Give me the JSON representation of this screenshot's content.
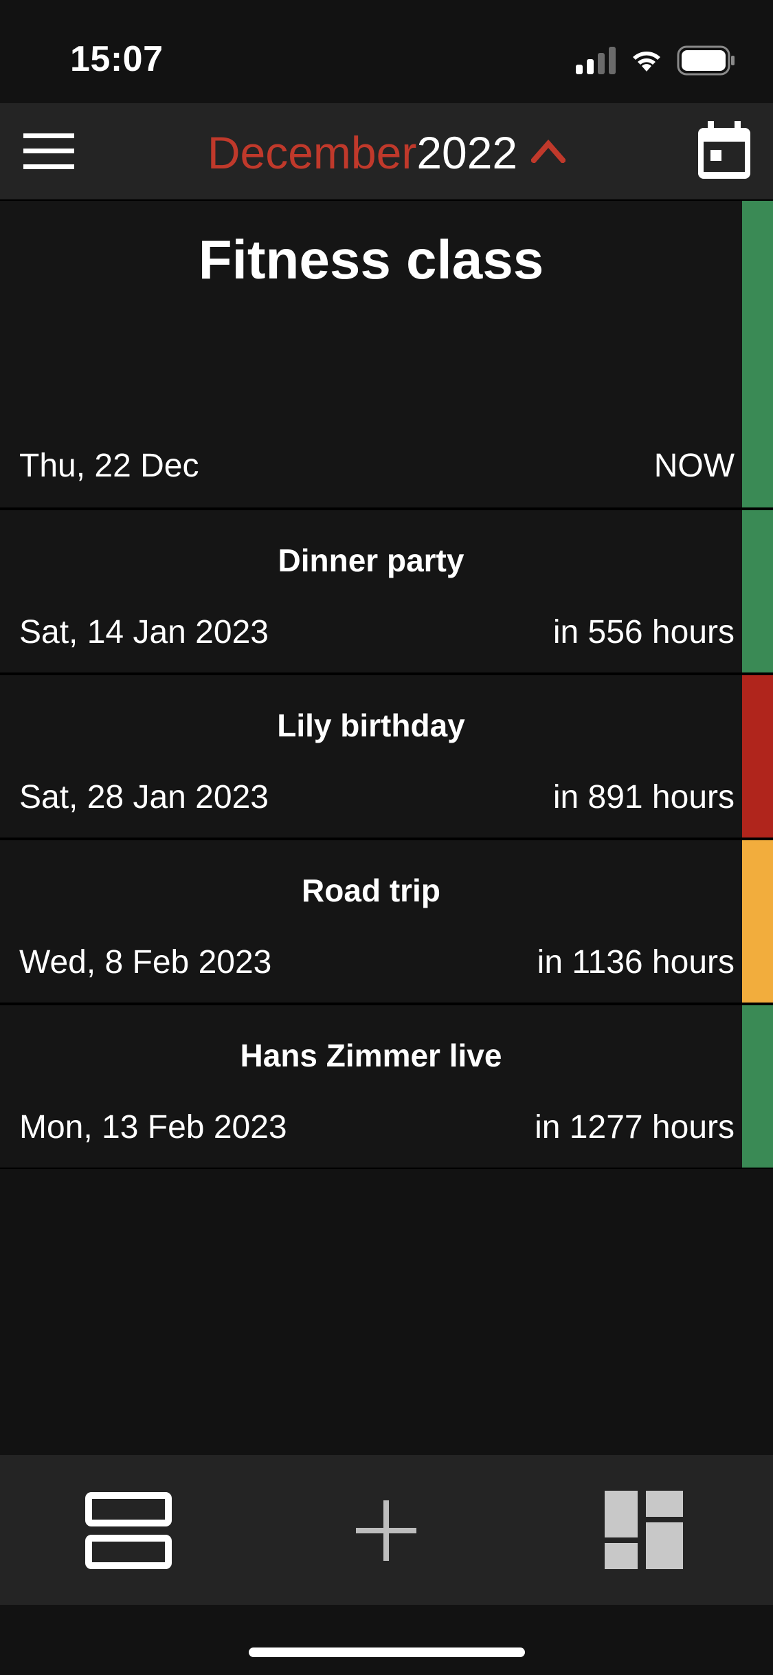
{
  "status_bar": {
    "time": "15:07"
  },
  "header": {
    "month": "December",
    "year": "2022",
    "icons": [
      "menu-icon",
      "chevron-up-icon",
      "calendar-icon"
    ]
  },
  "colors": {
    "accent": "#c0392b",
    "green": "#3a8a55",
    "red": "#b0251c",
    "orange": "#f2ad3d"
  },
  "events": [
    {
      "title": "Fitness class",
      "date": "Thu, 22 Dec",
      "countdown": "NOW",
      "color": "#3a8a55"
    },
    {
      "title": "Dinner party",
      "date": "Sat, 14 Jan 2023",
      "countdown": "in 556 hours",
      "color": "#3a8a55"
    },
    {
      "title": "Lily birthday",
      "date": "Sat, 28 Jan 2023",
      "countdown": "in 891 hours",
      "color": "#b0251c"
    },
    {
      "title": "Road trip",
      "date": "Wed, 8 Feb 2023",
      "countdown": "in 1136 hours",
      "color": "#f2ad3d"
    },
    {
      "title": "Hans Zimmer live",
      "date": "Mon, 13 Feb 2023",
      "countdown": "in 1277 hours",
      "color": "#3a8a55"
    }
  ],
  "bottom_bar": {
    "icons": [
      "list-view-icon",
      "add-icon",
      "dashboard-icon"
    ]
  }
}
